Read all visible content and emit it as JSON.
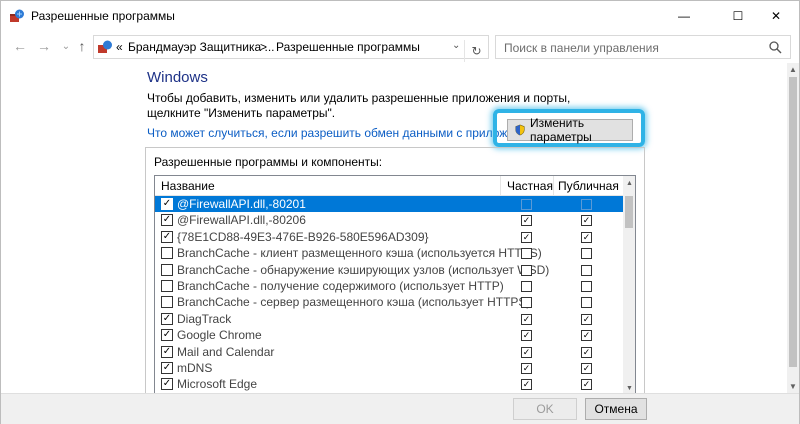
{
  "window": {
    "title": "Разрешенные программы",
    "minimize_glyph": "—",
    "maximize_glyph": "☐",
    "close_glyph": "✕"
  },
  "nav": {
    "back_glyph": "←",
    "forward_glyph": "→",
    "dropdown_glyph": "⌄",
    "up_glyph": "↑",
    "breadcrumb": {
      "prefix": "«",
      "parent": "Брандмауэр Защитника ...",
      "separator": ">",
      "current": "Разрешенные программы"
    },
    "refresh_glyph": "↻",
    "search_placeholder": "Поиск в панели управления"
  },
  "content": {
    "heading": "Windows",
    "description": "Чтобы добавить, изменить или удалить разрешенные приложения и порты, щелкните \"Изменить параметры\".",
    "risk_link": "Что может случиться, если разрешить обмен данными с приложением?",
    "change_settings_label": "Изменить параметры",
    "group_label": "Разрешенные программы и компоненты:",
    "table": {
      "columns": [
        "Название",
        "Частная",
        "Публичная"
      ],
      "rows": [
        {
          "name": "@FirewallAPI.dll,-80201",
          "enabled": true,
          "private": false,
          "public": false,
          "selected": true
        },
        {
          "name": "@FirewallAPI.dll,-80206",
          "enabled": true,
          "private": true,
          "public": true,
          "selected": false
        },
        {
          "name": "{78E1CD88-49E3-476E-B926-580E596AD309}",
          "enabled": true,
          "private": true,
          "public": true,
          "selected": false
        },
        {
          "name": "BranchCache - клиент размещенного кэша (используется HTTPS)",
          "enabled": false,
          "private": false,
          "public": false,
          "selected": false
        },
        {
          "name": "BranchCache - обнаружение кэширующих узлов (использует WSD)",
          "enabled": false,
          "private": false,
          "public": false,
          "selected": false
        },
        {
          "name": "BranchCache - получение содержимого (использует HTTP)",
          "enabled": false,
          "private": false,
          "public": false,
          "selected": false
        },
        {
          "name": "BranchCache - сервер размещенного кэша (использует HTTPS)",
          "enabled": false,
          "private": false,
          "public": false,
          "selected": false
        },
        {
          "name": "DiagTrack",
          "enabled": true,
          "private": true,
          "public": true,
          "selected": false
        },
        {
          "name": "Google Chrome",
          "enabled": true,
          "private": true,
          "public": true,
          "selected": false
        },
        {
          "name": "Mail and Calendar",
          "enabled": true,
          "private": true,
          "public": true,
          "selected": false
        },
        {
          "name": "mDNS",
          "enabled": true,
          "private": true,
          "public": true,
          "selected": false
        },
        {
          "name": "Microsoft Edge",
          "enabled": true,
          "private": true,
          "public": true,
          "selected": false
        }
      ]
    }
  },
  "footer": {
    "ok_label": "OK",
    "cancel_label": "Отмена"
  },
  "colors": {
    "selection": "#0078d7",
    "link": "#0b5dc4",
    "heading": "#1e3287",
    "highlight_glow": "#2fb3e6"
  }
}
